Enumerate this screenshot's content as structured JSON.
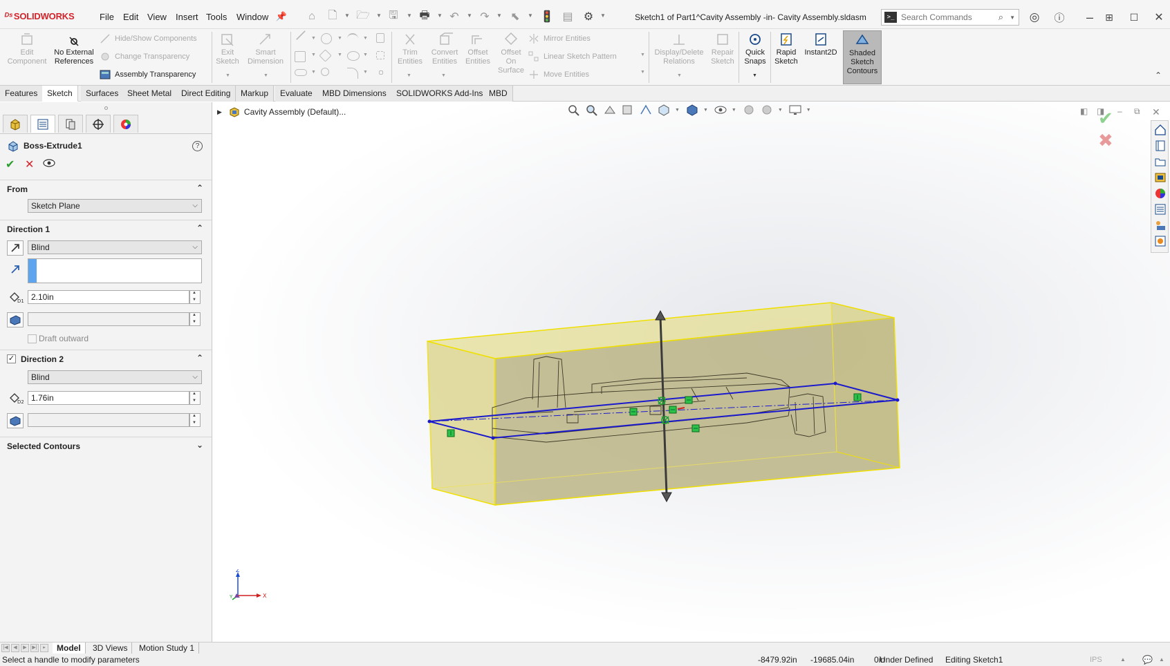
{
  "app": {
    "logo": "SOLIDWORKS",
    "document_title": "Sketch1 of Part1^Cavity Assembly -in- Cavity Assembly.sldasm"
  },
  "menu": [
    "File",
    "Edit",
    "View",
    "Insert",
    "Tools",
    "Window"
  ],
  "search": {
    "placeholder": "Search Commands"
  },
  "ribbon": {
    "edit_component": "Edit Component",
    "no_external_references": "No External References",
    "hide_show_components": "Hide/Show Components",
    "change_transparency": "Change Transparency",
    "assembly_transparency": "Assembly Transparency",
    "exit_sketch": "Exit Sketch",
    "smart_dimension": "Smart Dimension",
    "trim_entities": "Trim Entities",
    "convert_entities": "Convert Entities",
    "offset_entities": "Offset Entities",
    "offset_on_surface": "Offset On Surface",
    "mirror_entities": "Mirror Entities",
    "linear_sketch_pattern": "Linear Sketch Pattern",
    "move_entities": "Move Entities",
    "display_delete_relations": "Display/Delete Relations",
    "repair_sketch": "Repair Sketch",
    "quick_snaps": "Quick Snaps",
    "rapid_sketch": "Rapid Sketch",
    "instant2d": "Instant2D",
    "shaded_sketch_contours": "Shaded Sketch Contours"
  },
  "tabs": [
    "Features",
    "Sketch",
    "Surfaces",
    "Sheet Metal",
    "Direct Editing",
    "Markup",
    "Evaluate",
    "MBD Dimensions",
    "SOLIDWORKS Add-Ins",
    "MBD"
  ],
  "active_tab": "Sketch",
  "property_manager": {
    "title": "Boss-Extrude1",
    "from": {
      "label": "From",
      "value": "Sketch Plane"
    },
    "direction1": {
      "label": "Direction 1",
      "end_condition": "Blind",
      "depth": "2.10in",
      "draft_label": "Draft outward"
    },
    "direction2": {
      "label": "Direction 2",
      "checked": true,
      "end_condition": "Blind",
      "depth": "1.76in"
    },
    "selected_contours": "Selected Contours"
  },
  "viewport": {
    "tree_root": "Cavity Assembly  (Default)...",
    "triad": {
      "x": "X",
      "y": "Y",
      "z": "Z"
    }
  },
  "bottom_tabs": [
    "Model",
    "3D Views",
    "Motion Study 1"
  ],
  "active_bottom_tab": "Model",
  "status": {
    "message": "Select a handle to modify parameters",
    "x": "-8479.92in",
    "y": "-19685.04in",
    "z": "0in",
    "state": "Under Defined",
    "editing": "Editing Sketch1",
    "units": "IPS"
  },
  "colors": {
    "accent_red": "#d2232a",
    "sketch_blue": "#1a1acc",
    "preview_yellow": "#d8d28a",
    "preview_edge": "#f0e000",
    "ok_green": "#2a9d2a"
  }
}
